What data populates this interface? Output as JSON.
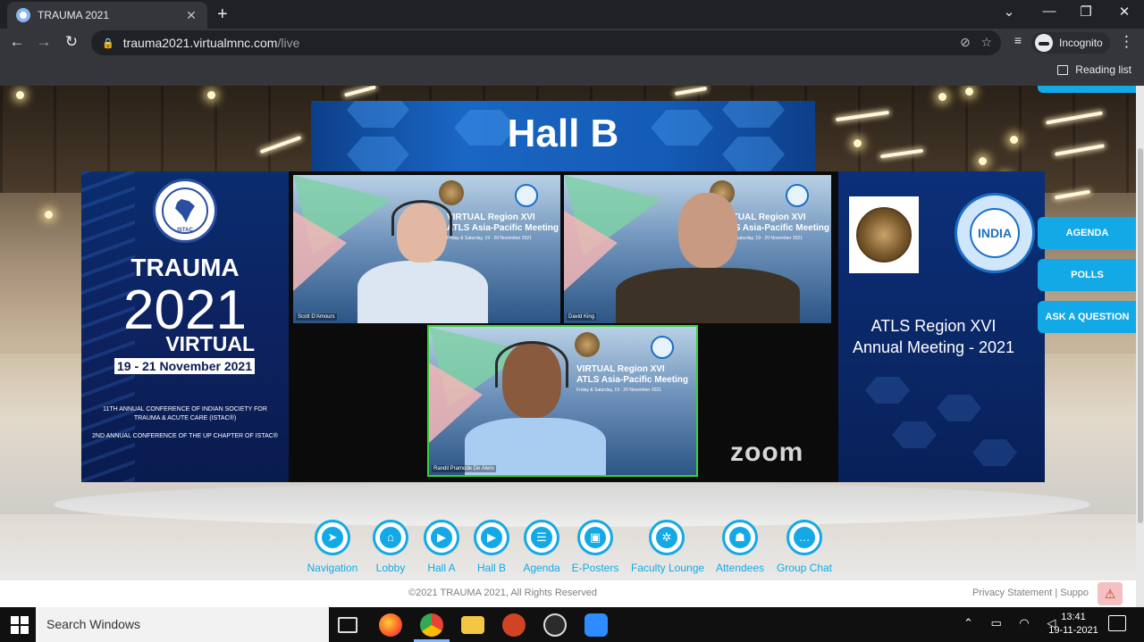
{
  "browser": {
    "tab_title": "TRAUMA 2021",
    "tab_close": "✕",
    "new_tab": "+",
    "url_host": "trauma2021.virtualmnc.com",
    "url_path": "/live",
    "incognito_label": "Incognito",
    "reading_list_label": "Reading list"
  },
  "hall": {
    "title": "Hall B"
  },
  "left_panel": {
    "seal_text": "ISTAC",
    "trauma": "TRAUMA",
    "year": "2021",
    "virtual": "VIRTUAL",
    "dates": "19 - 21 November 2021",
    "conf1": "11TH ANNUAL CONFERENCE OF INDIAN SOCIETY FOR TRAUMA & ACUTE CARE (ISTAC®)",
    "conf2": "2ND ANNUAL CONFERENCE OF THE UP CHAPTER OF ISTAC®"
  },
  "right_panel": {
    "seal_text": "INDIA",
    "title_line1": "ATLS Region XVI",
    "title_line2": "Annual Meeting - 2021"
  },
  "videos": [
    {
      "name": "Scott D'Amours",
      "bg_title": "VIRTUAL Region XVI\nATLS Asia-Pacific Meeting",
      "bg_sub": "Friday & Saturday, 19 - 20 November 2021"
    },
    {
      "name": "David King",
      "bg_title": "VIRTUAL Region XVI\nATLS Asia-Pacific Meeting",
      "bg_sub": "Friday & Saturday, 19 - 20 November 2021"
    },
    {
      "name": "Randil Pramode De Alwis",
      "bg_title": "VIRTUAL Region XVI\nATLS Asia-Pacific Meeting",
      "bg_sub": "Friday & Saturday, 19 - 20 November 2021"
    }
  ],
  "zoom_logo": "zoom",
  "side_buttons": [
    "AGENDA",
    "POLLS",
    "ASK A QUESTION"
  ],
  "nav_items": [
    {
      "label": "Navigation",
      "icon": "navigation-icon"
    },
    {
      "label": "Lobby",
      "icon": "lobby-icon"
    },
    {
      "label": "Hall A",
      "icon": "hall-a-icon"
    },
    {
      "label": "Hall B",
      "icon": "hall-b-icon"
    },
    {
      "label": "Agenda",
      "icon": "agenda-icon"
    },
    {
      "label": "E-Posters",
      "icon": "e-posters-icon"
    },
    {
      "label": "Faculty Lounge",
      "icon": "faculty-lounge-icon"
    },
    {
      "label": "Attendees",
      "icon": "attendees-icon"
    },
    {
      "label": "Group Chat",
      "icon": "group-chat-icon"
    }
  ],
  "footer": {
    "copyright": "©2021 TRAUMA 2021, All Rights Reserved",
    "links": "Privacy Statement | Suppo"
  },
  "taskbar": {
    "search_placeholder": "Search Windows",
    "time": "13:41",
    "date": "19-11-2021"
  },
  "colors": {
    "accent": "#12a9e6",
    "chrome_dark": "#202124",
    "chrome_toolbar": "#35363a",
    "banner_blue": "#1a66c4",
    "active_speaker": "#3ad13a"
  }
}
